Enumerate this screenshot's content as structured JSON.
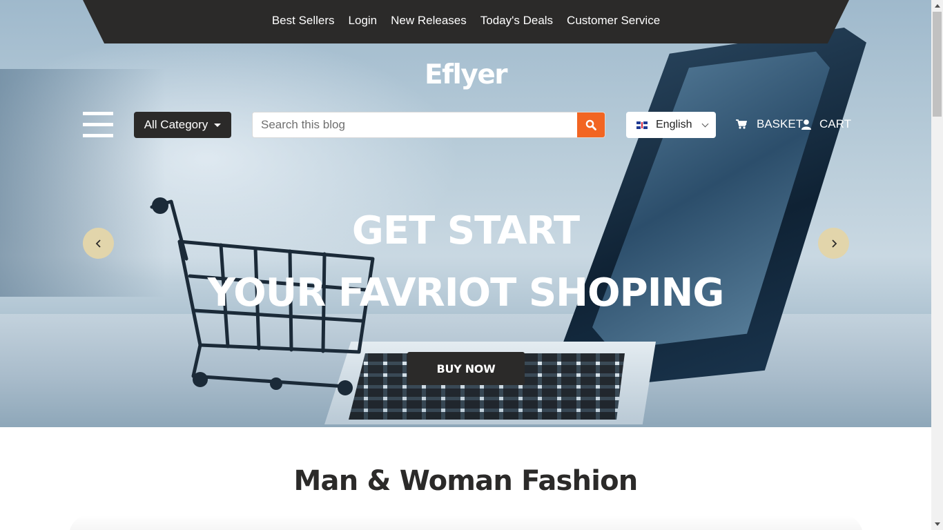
{
  "topnav": {
    "items": [
      {
        "label": "Best Sellers"
      },
      {
        "label": "Login"
      },
      {
        "label": "New Releases"
      },
      {
        "label": "Today's Deals"
      },
      {
        "label": "Customer Service"
      }
    ]
  },
  "brand": {
    "logo": "Eflyer"
  },
  "header": {
    "category_label": "All Category",
    "search_placeholder": "Search this blog",
    "language": "English",
    "basket_label": "BASKET",
    "cart_label": "CART"
  },
  "hero": {
    "line1": "GET START",
    "line2": "YOUR FAVRIOT SHOPING",
    "cta_label": "BUY NOW"
  },
  "section": {
    "title": "Man & Woman Fashion"
  },
  "icons": {
    "menu": "hamburger-menu-icon",
    "search": "search-icon",
    "flag": "uk-flag-icon",
    "chevron": "chevron-down-icon",
    "cart": "shopping-cart-icon",
    "user": "user-icon",
    "prev": "chevron-left-icon",
    "next": "chevron-right-icon"
  },
  "colors": {
    "dark": "#2b2a29",
    "accent": "#f26522",
    "arrow_bg": "#e2d5ab",
    "text_white": "#ffffff"
  }
}
